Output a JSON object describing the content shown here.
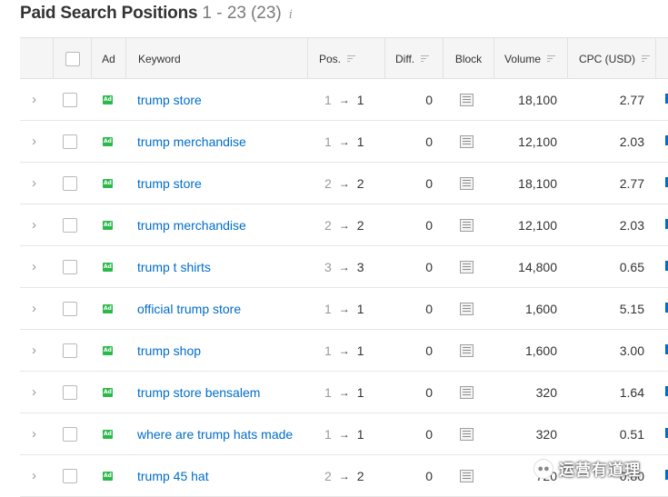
{
  "header": {
    "title": "Paid Search Positions",
    "range": "1 - 23",
    "total": "(23)",
    "info_icon": "info-icon",
    "info_glyph": "i"
  },
  "columns": {
    "ad": "Ad",
    "keyword": "Keyword",
    "pos": "Pos.",
    "diff": "Diff.",
    "block": "Block",
    "volume": "Volume",
    "cpc": "CPC (USD)"
  },
  "ad_badge": "Ad",
  "rows": [
    {
      "keyword": "trump store",
      "pos_prev": "1",
      "pos_cur": "1",
      "diff": "0",
      "volume": "18,100",
      "cpc": "2.77"
    },
    {
      "keyword": "trump merchandise",
      "pos_prev": "1",
      "pos_cur": "1",
      "diff": "0",
      "volume": "12,100",
      "cpc": "2.03"
    },
    {
      "keyword": "trump store",
      "pos_prev": "2",
      "pos_cur": "2",
      "diff": "0",
      "volume": "18,100",
      "cpc": "2.77"
    },
    {
      "keyword": "trump merchandise",
      "pos_prev": "2",
      "pos_cur": "2",
      "diff": "0",
      "volume": "12,100",
      "cpc": "2.03"
    },
    {
      "keyword": "trump t shirts",
      "pos_prev": "3",
      "pos_cur": "3",
      "diff": "0",
      "volume": "14,800",
      "cpc": "0.65"
    },
    {
      "keyword": "official trump store",
      "pos_prev": "1",
      "pos_cur": "1",
      "diff": "0",
      "volume": "1,600",
      "cpc": "5.15"
    },
    {
      "keyword": "trump shop",
      "pos_prev": "1",
      "pos_cur": "1",
      "diff": "0",
      "volume": "1,600",
      "cpc": "3.00"
    },
    {
      "keyword": "trump store bensalem",
      "pos_prev": "1",
      "pos_cur": "1",
      "diff": "0",
      "volume": "320",
      "cpc": "1.64"
    },
    {
      "keyword": "where are trump hats made",
      "pos_prev": "1",
      "pos_cur": "1",
      "diff": "0",
      "volume": "320",
      "cpc": "0.51"
    },
    {
      "keyword": "trump 45 hat",
      "pos_prev": "2",
      "pos_cur": "2",
      "diff": "0",
      "volume": "720",
      "cpc": "0.80"
    }
  ],
  "watermark": {
    "text": "运营有道理",
    "icon": "wechat-icon"
  },
  "colors": {
    "link": "#006dca",
    "ad_badge": "#2db84b",
    "header_bg": "#f5f5f5"
  }
}
